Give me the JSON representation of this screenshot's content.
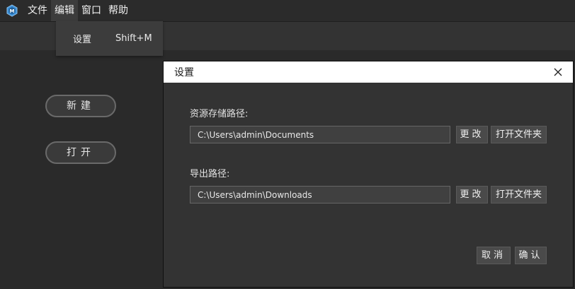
{
  "menubar": {
    "logo_icon": "app-logo-icon",
    "items": [
      {
        "label": "文件"
      },
      {
        "label": "编辑"
      },
      {
        "label": "窗口"
      },
      {
        "label": "帮助"
      }
    ]
  },
  "dropdown": {
    "items": [
      {
        "label": "设置",
        "shortcut": "Shift+M"
      }
    ]
  },
  "left_panel": {
    "new_label": "新建",
    "open_label": "打开"
  },
  "dialog": {
    "title": "设置",
    "close_icon": "close-icon",
    "resource_path": {
      "label": "资源存储路径:",
      "value": "C:\\Users\\admin\\Documents",
      "change_label": "更改",
      "open_folder_label": "打开文件夹"
    },
    "export_path": {
      "label": "导出路径:",
      "value": "C:\\Users\\admin\\Downloads",
      "change_label": "更改",
      "open_folder_label": "打开文件夹"
    },
    "cancel_label": "取消",
    "confirm_label": "确认"
  },
  "colors": {
    "background": "#2a2a2a",
    "dialog_bg": "#333333",
    "titlebar_bg": "#ffffff",
    "logo_accent": "#3b8fd6"
  }
}
